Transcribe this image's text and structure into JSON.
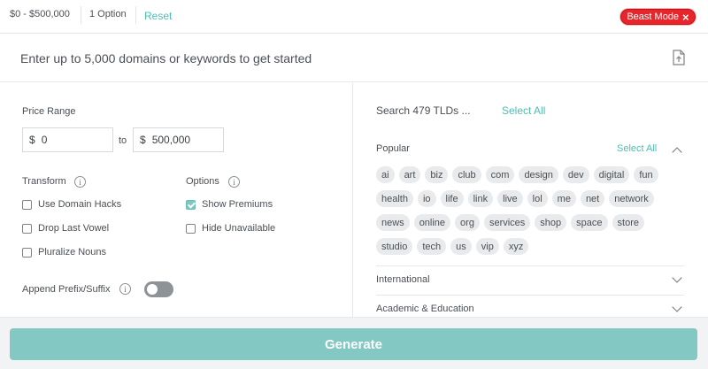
{
  "filters": {
    "price_chip": "$0 - $500,000",
    "options_chip": "1 Option",
    "reset_label": "Reset"
  },
  "beast_mode": {
    "label": "Beast Mode",
    "close_icon": "×",
    "color": "#e7262b"
  },
  "search": {
    "placeholder": "Enter up to 5,000 domains or keywords to get started",
    "upload_icon": "file-upload-icon"
  },
  "price_range": {
    "label": "Price Range",
    "min_currency": "$",
    "min_value": "0",
    "to_label": "to",
    "max_currency": "$",
    "max_value": "500,000"
  },
  "transform": {
    "label": "Transform",
    "items": [
      {
        "label": "Use Domain Hacks",
        "checked": false
      },
      {
        "label": "Drop Last Vowel",
        "checked": false
      },
      {
        "label": "Pluralize Nouns",
        "checked": false
      }
    ]
  },
  "options": {
    "label": "Options",
    "items": [
      {
        "label": "Show Premiums",
        "checked": true
      },
      {
        "label": "Hide Unavailable",
        "checked": false
      }
    ]
  },
  "append": {
    "label": "Append Prefix/Suffix",
    "enabled": false
  },
  "tlds": {
    "search_placeholder": "Search 479 TLDs ...",
    "select_all_label": "Select All",
    "popular_label": "Popular",
    "popular_select_all": "Select All",
    "popular": [
      "ai",
      "art",
      "biz",
      "club",
      "com",
      "design",
      "dev",
      "digital",
      "fun",
      "health",
      "io",
      "life",
      "link",
      "live",
      "lol",
      "me",
      "net",
      "network",
      "news",
      "online",
      "org",
      "services",
      "shop",
      "space",
      "store",
      "studio",
      "tech",
      "us",
      "vip",
      "xyz"
    ],
    "sections": [
      {
        "label": "International"
      },
      {
        "label": "Academic & Education"
      }
    ]
  },
  "generate_label": "Generate",
  "accent_color": "#4dbdb6"
}
